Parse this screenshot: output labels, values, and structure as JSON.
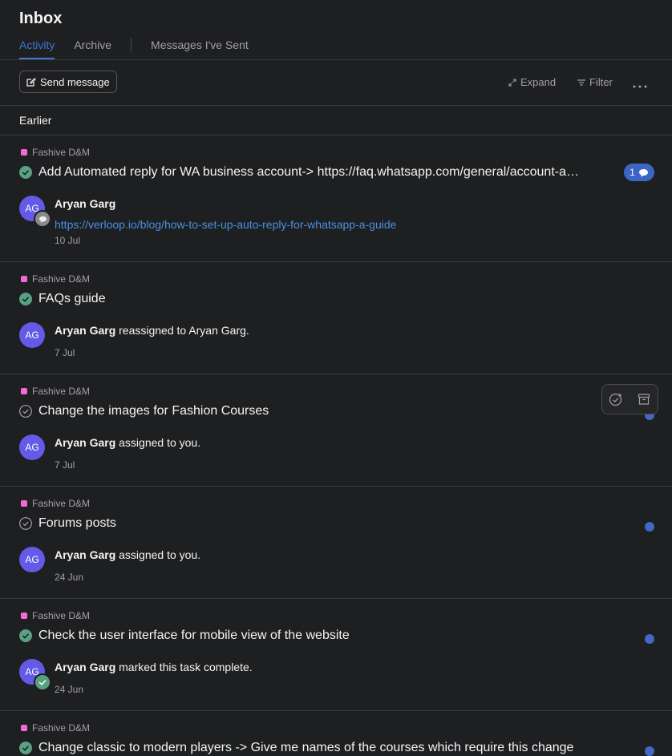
{
  "header": {
    "title": "Inbox",
    "tabs": [
      {
        "label": "Activity"
      },
      {
        "label": "Archive"
      },
      {
        "label": "Messages I've Sent"
      }
    ]
  },
  "toolbar": {
    "send_label": "Send message",
    "expand_label": "Expand",
    "filter_label": "Filter"
  },
  "section_label": "Earlier",
  "items": [
    {
      "project": "Fashive D&M",
      "title": "Add Automated reply for WA business account-> https://faq.whatsapp.com/general/account-a…",
      "status": "complete",
      "avatar": "AG",
      "actor": "Aryan Garg",
      "link": "https://verloop.io/blog/how-to-set-up-auto-reply-for-whatsapp-a-guide",
      "date": "10 Jul",
      "comment_count": "1",
      "avatar_badge": "comment-icon"
    },
    {
      "project": "Fashive D&M",
      "title": "FAQs guide",
      "status": "complete",
      "avatar": "AG",
      "actor": "Aryan Garg",
      "action": " reassigned to Aryan Garg.",
      "date": "7 Jul"
    },
    {
      "project": "Fashive D&M",
      "title": "Change the images for Fashion Courses",
      "status": "incomplete",
      "avatar": "AG",
      "actor": "Aryan Garg",
      "action": " assigned to you.",
      "date": "7 Jul",
      "unread": true
    },
    {
      "project": "Fashive D&M",
      "title": "Forums posts",
      "status": "incomplete",
      "avatar": "AG",
      "actor": "Aryan Garg",
      "action": " assigned to you.",
      "date": "24 Jun",
      "unread": true
    },
    {
      "project": "Fashive D&M",
      "title": "Check the user interface for mobile view of the website",
      "status": "complete",
      "avatar": "AG",
      "actor": "Aryan Garg",
      "action": " marked this task complete.",
      "date": "24 Jun",
      "unread": true,
      "avatar_badge": "check-icon"
    },
    {
      "project": "Fashive D&M",
      "title": "Change classic to modern players -> Give me names of the courses which require this change",
      "status": "complete",
      "unread": true
    }
  ],
  "colors": {
    "background": "#1e1f21",
    "accent": "#4573d2",
    "project": "#f06bd8",
    "complete": "#58a182",
    "avatar": "#6559e8",
    "unread": "#3f6ac4"
  }
}
